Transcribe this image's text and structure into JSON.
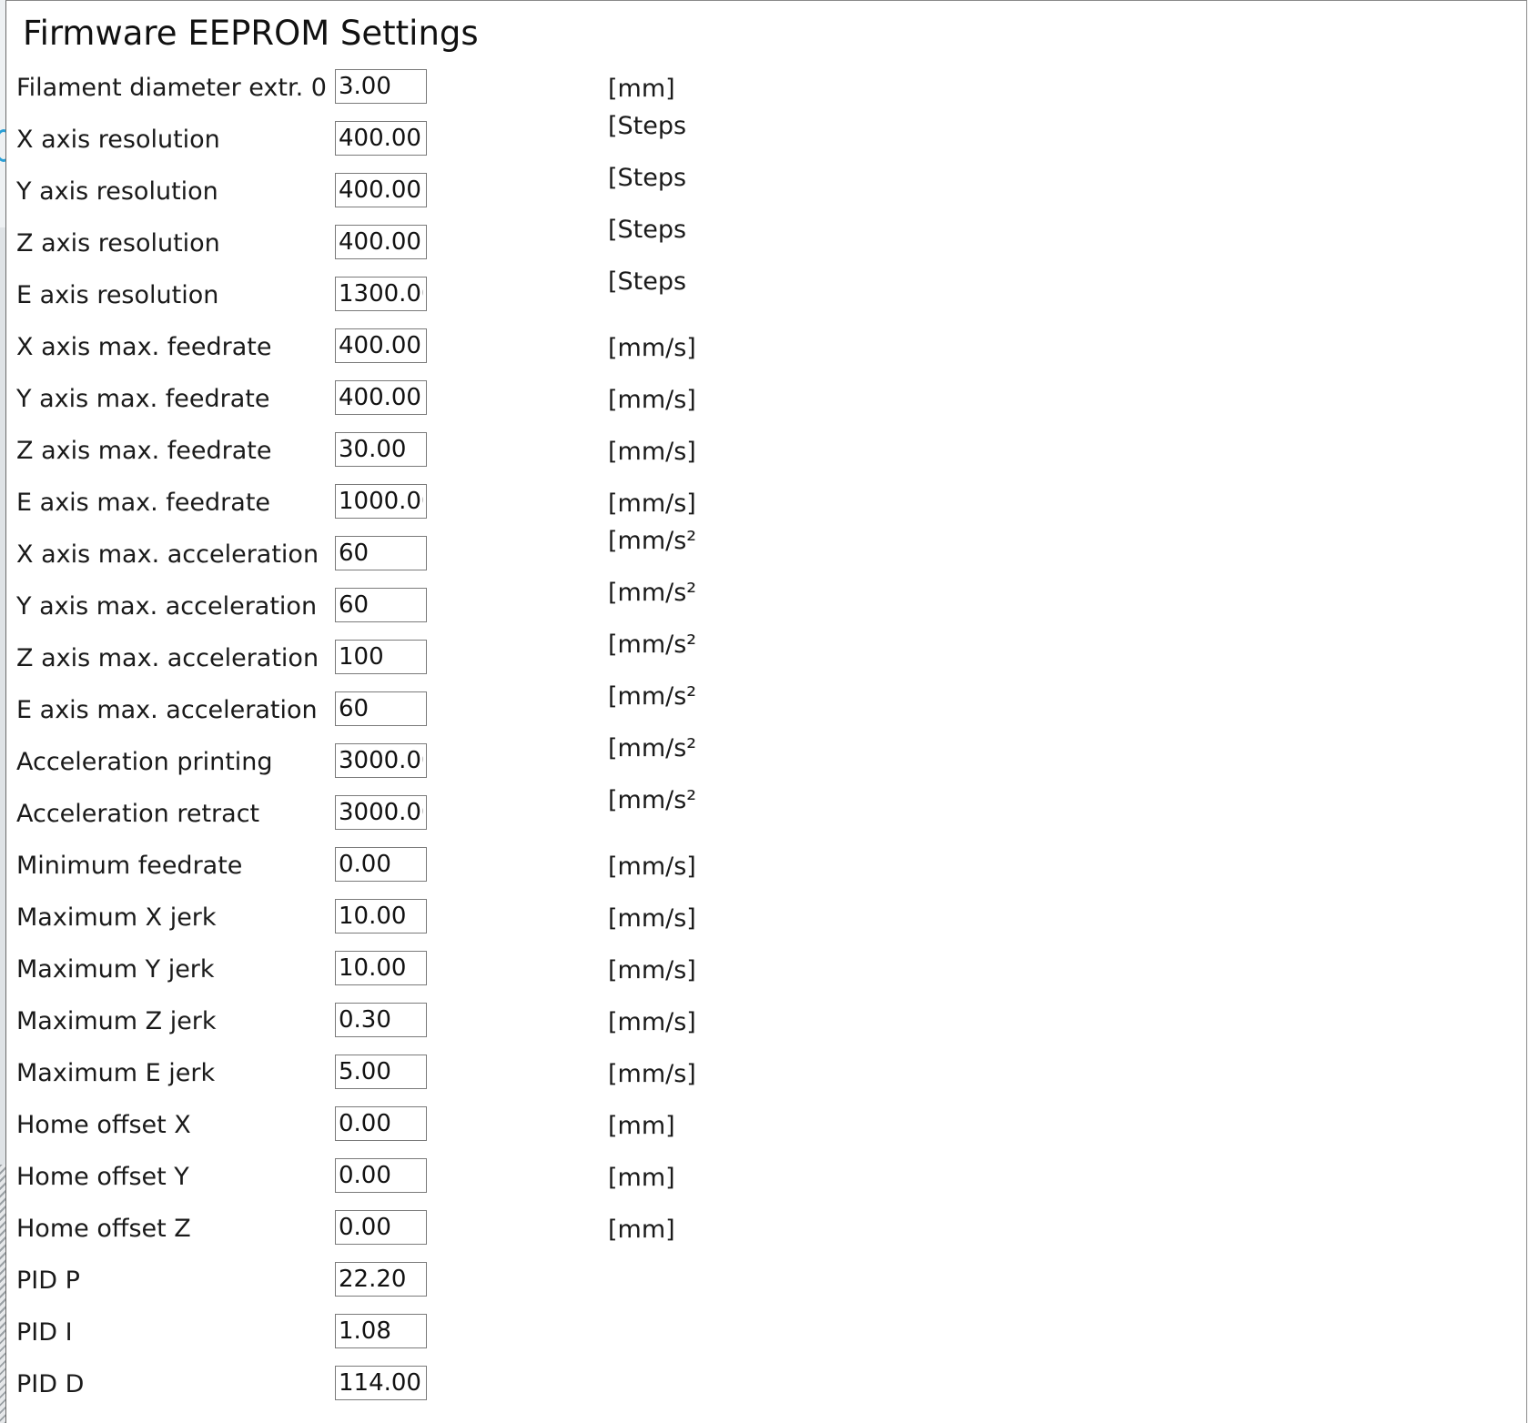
{
  "dialog": {
    "title": "Firmware EEPROM Settings"
  },
  "settings": [
    {
      "label": "Filament diameter extr. 0",
      "value": "3.00",
      "unit": "[mm]",
      "unit_raised": false
    },
    {
      "label": "X axis resolution",
      "value": "400.00",
      "unit": "[Steps",
      "unit_raised": true
    },
    {
      "label": "Y axis resolution",
      "value": "400.00",
      "unit": "[Steps",
      "unit_raised": true
    },
    {
      "label": "Z axis resolution",
      "value": "400.00",
      "unit": "[Steps",
      "unit_raised": true
    },
    {
      "label": "E axis resolution",
      "value": "1300.00",
      "unit": "[Steps",
      "unit_raised": true
    },
    {
      "label": "X axis max. feedrate",
      "value": "400.00",
      "unit": "[mm/s]",
      "unit_raised": false
    },
    {
      "label": "Y axis max. feedrate",
      "value": "400.00",
      "unit": "[mm/s]",
      "unit_raised": false
    },
    {
      "label": "Z axis max. feedrate",
      "value": "30.00",
      "unit": "[mm/s]",
      "unit_raised": false
    },
    {
      "label": "E axis max. feedrate",
      "value": "1000.00",
      "unit": "[mm/s]",
      "unit_raised": false
    },
    {
      "label": "X axis max. acceleration",
      "value": "60",
      "unit": "[mm/s²",
      "unit_raised": true
    },
    {
      "label": "Y axis max. acceleration",
      "value": "60",
      "unit": "[mm/s²",
      "unit_raised": true
    },
    {
      "label": "Z axis max. acceleration",
      "value": "100",
      "unit": "[mm/s²",
      "unit_raised": true
    },
    {
      "label": "E axis max. acceleration",
      "value": "60",
      "unit": "[mm/s²",
      "unit_raised": true
    },
    {
      "label": "Acceleration printing",
      "value": "3000.00",
      "unit": "[mm/s²",
      "unit_raised": true
    },
    {
      "label": "Acceleration retract",
      "value": "3000.00",
      "unit": "[mm/s²",
      "unit_raised": true
    },
    {
      "label": "Minimum feedrate",
      "value": "0.00",
      "unit": "[mm/s]",
      "unit_raised": false
    },
    {
      "label": "Maximum X jerk",
      "value": "10.00",
      "unit": "[mm/s]",
      "unit_raised": false
    },
    {
      "label": "Maximum Y jerk",
      "value": "10.00",
      "unit": "[mm/s]",
      "unit_raised": false
    },
    {
      "label": "Maximum Z jerk",
      "value": "0.30",
      "unit": "[mm/s]",
      "unit_raised": false
    },
    {
      "label": "Maximum E jerk",
      "value": "5.00",
      "unit": "[mm/s]",
      "unit_raised": false
    },
    {
      "label": "Home offset X",
      "value": "0.00",
      "unit": "[mm]",
      "unit_raised": false
    },
    {
      "label": "Home offset Y",
      "value": "0.00",
      "unit": "[mm]",
      "unit_raised": false
    },
    {
      "label": "Home offset Z",
      "value": "0.00",
      "unit": "[mm]",
      "unit_raised": false
    },
    {
      "label": "PID P",
      "value": "22.20",
      "unit": "",
      "unit_raised": false
    },
    {
      "label": "PID I",
      "value": "1.08",
      "unit": "",
      "unit_raised": false
    },
    {
      "label": "PID D",
      "value": "114.00",
      "unit": "",
      "unit_raised": false
    }
  ]
}
